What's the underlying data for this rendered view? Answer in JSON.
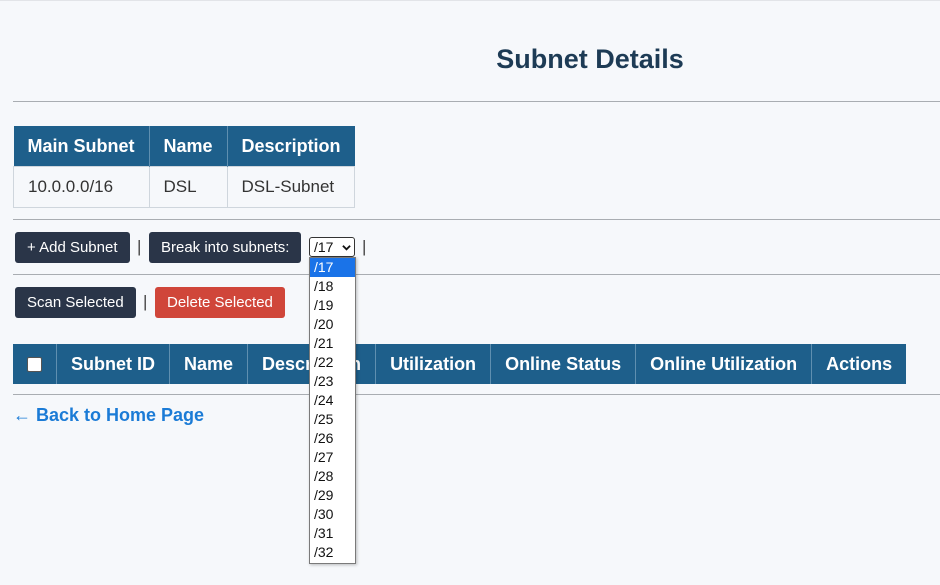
{
  "page": {
    "title": "Subnet Details"
  },
  "main_subnet_table": {
    "headers": [
      "Main Subnet",
      "Name",
      "Description"
    ],
    "row": [
      "10.0.0.0/16",
      "DSL",
      "DSL-Subnet"
    ]
  },
  "toolbar": {
    "add_subnet": "+ Add Subnet",
    "separator": "|",
    "break_into": "Break into subnets:",
    "selected_prefix": "/17",
    "prefix_options": [
      "/17",
      "/18",
      "/19",
      "/20",
      "/21",
      "/22",
      "/23",
      "/24",
      "/25",
      "/26",
      "/27",
      "/28",
      "/29",
      "/30",
      "/31",
      "/32"
    ],
    "scan_selected": "Scan Selected",
    "delete_selected": "Delete Selected"
  },
  "subnets_table": {
    "headers": [
      "Subnet ID",
      "Name",
      "Description",
      "Utilization",
      "Online Status",
      "Online Utilization",
      "Actions"
    ]
  },
  "back_link": "← Back to Home Page",
  "colors": {
    "header_bg": "#1e5f8b",
    "title": "#1d3b55",
    "danger": "#d0463a",
    "dark_button": "#2a3548",
    "link": "#1b7bd6"
  }
}
